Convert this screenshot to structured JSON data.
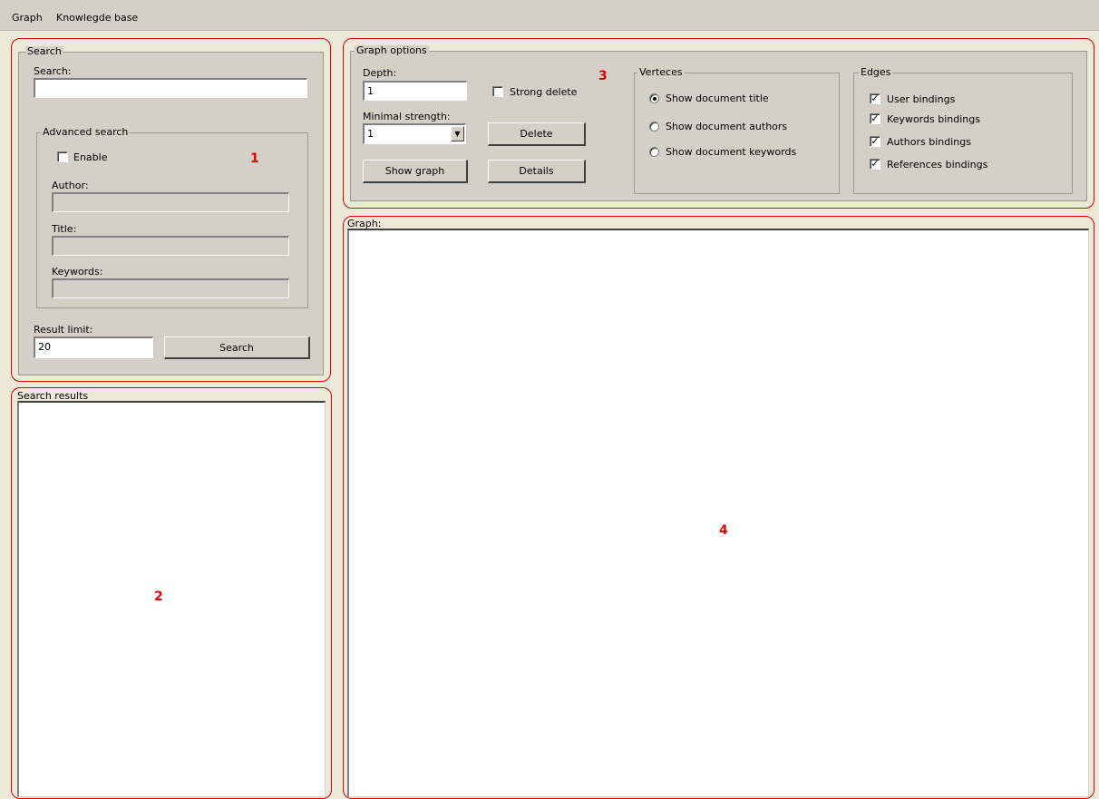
{
  "menu": {
    "items": [
      "Graph",
      "Knowlegde base"
    ]
  },
  "search_panel": {
    "legend": "Search",
    "search_label": "Search:",
    "search_value": "",
    "advanced": {
      "legend": "Advanced search",
      "enable_label": "Enable",
      "enable_checked": false,
      "author_label": "Author:",
      "title_label": "Title:",
      "keywords_label": "Keywords:"
    },
    "result_limit_label": "Result limit:",
    "result_limit_value": "20",
    "search_button": "Search"
  },
  "search_results": {
    "label": "Search results"
  },
  "graph_options": {
    "legend": "Graph options",
    "depth_label": "Depth:",
    "depth_value": "1",
    "strong_delete_label": "Strong delete",
    "strong_delete_checked": false,
    "minimal_strength_label": "Minimal strength:",
    "minimal_strength_value": "1",
    "delete_button": "Delete",
    "show_graph_button": "Show graph",
    "details_button": "Details",
    "verteces": {
      "legend": "Verteces",
      "options": [
        "Show document title",
        "Show document authors",
        "Show document keywords"
      ],
      "selected": "Show document title"
    },
    "edges": {
      "legend": "Edges",
      "items": [
        {
          "label": "User bindings",
          "checked": true
        },
        {
          "label": "Keywords bindings",
          "checked": true
        },
        {
          "label": "Authors bindings",
          "checked": true
        },
        {
          "label": "References bindings",
          "checked": true
        }
      ]
    }
  },
  "graph": {
    "label": "Graph:"
  },
  "markers": [
    "1",
    "2",
    "3",
    "4"
  ],
  "colors": {
    "marker": "#e00000",
    "window_bg": "#d4d0c8"
  }
}
